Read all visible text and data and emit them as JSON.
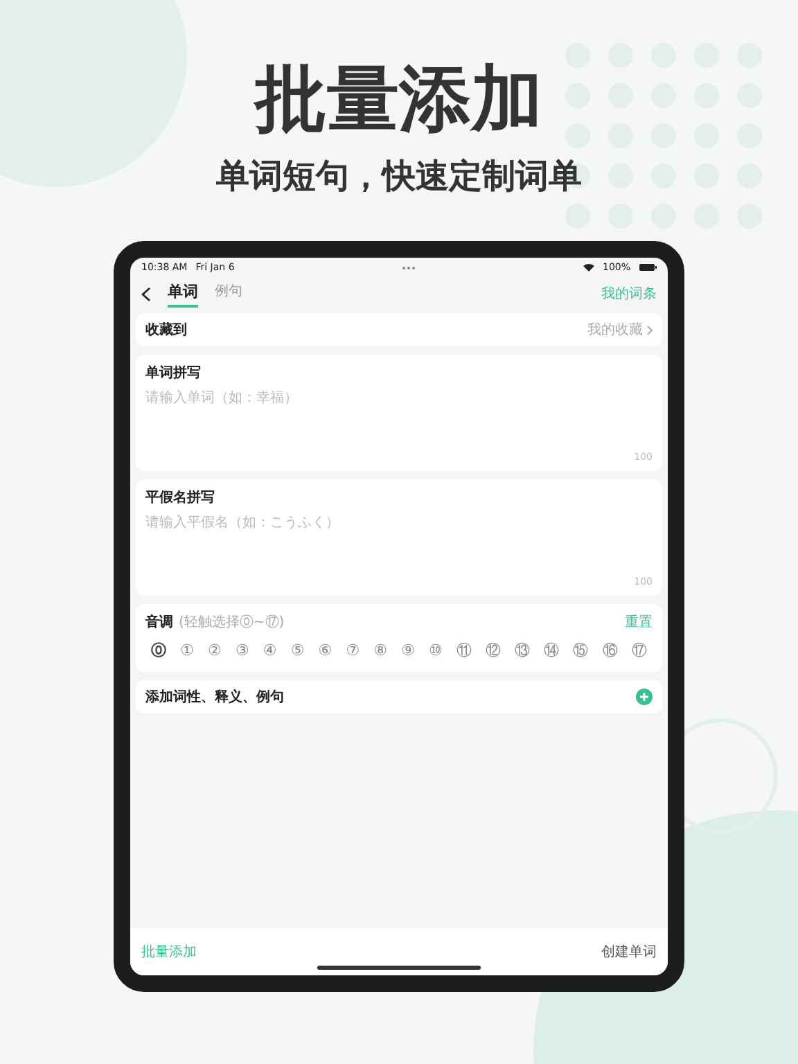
{
  "headline": "批量添加",
  "subtitle": "单词短句，快速定制词单",
  "status_bar": {
    "time": "10:38 AM",
    "date": "Fri Jan 6",
    "battery": "100%"
  },
  "nav": {
    "tabs": [
      {
        "label": "单词",
        "selected": true
      },
      {
        "label": "例句",
        "selected": false
      }
    ],
    "action": "我的词条"
  },
  "collect": {
    "label": "收藏到",
    "value": "我的收藏"
  },
  "fields": [
    {
      "label": "单词拼写",
      "placeholder": "请输入单词（如：幸福）",
      "counter": "100"
    },
    {
      "label": "平假名拼写",
      "placeholder": "请输入平假名（如：こうふく）",
      "counter": "100"
    }
  ],
  "tone": {
    "label": "音调",
    "hint": "(轻触选择⓪~⑰)",
    "reset": "重置",
    "options": [
      {
        "label": "⓪",
        "selected": true
      },
      {
        "label": "①",
        "selected": false
      },
      {
        "label": "②",
        "selected": false
      },
      {
        "label": "③",
        "selected": false
      },
      {
        "label": "④",
        "selected": false
      },
      {
        "label": "⑤",
        "selected": false
      },
      {
        "label": "⑥",
        "selected": false
      },
      {
        "label": "⑦",
        "selected": false
      },
      {
        "label": "⑧",
        "selected": false
      },
      {
        "label": "⑨",
        "selected": false
      },
      {
        "label": "⑩",
        "selected": false
      },
      {
        "label": "⑪",
        "selected": false
      },
      {
        "label": "⑫",
        "selected": false
      },
      {
        "label": "⑬",
        "selected": false
      },
      {
        "label": "⑭",
        "selected": false
      },
      {
        "label": "⑮",
        "selected": false
      },
      {
        "label": "⑯",
        "selected": false
      },
      {
        "label": "⑰",
        "selected": false
      }
    ]
  },
  "add_row": {
    "label": "添加词性、释义、例句"
  },
  "bottom": {
    "left": "批量添加",
    "right": "创建单词"
  }
}
